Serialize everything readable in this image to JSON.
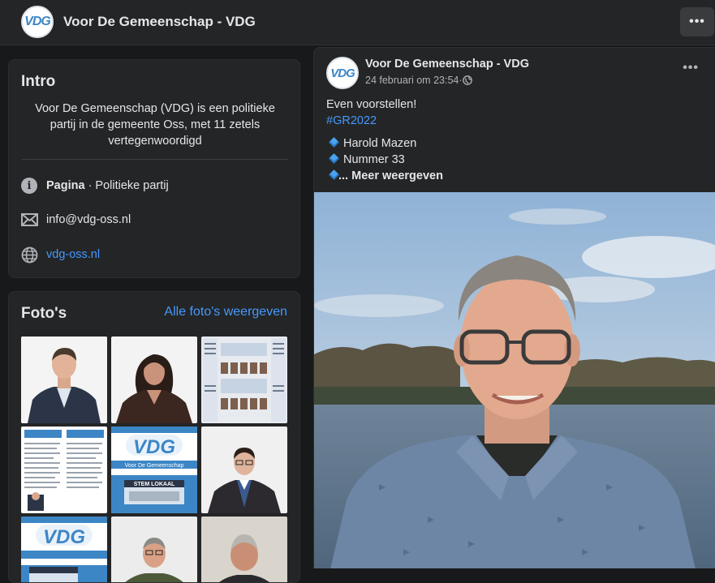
{
  "header": {
    "page_name": "Voor De Gemeenschap - VDG",
    "logo_text": "VDG",
    "more_label": "•••"
  },
  "intro": {
    "title": "Intro",
    "description": "Voor De Gemeenschap (VDG) is een politieke partij in de gemeente Oss, met 11 zetels vertegenwoordigd",
    "category_label": "Pagina",
    "category_value": " · Politieke partij",
    "email": "info@vdg-oss.nl",
    "website": "vdg-oss.nl"
  },
  "photos": {
    "title": "Foto's",
    "see_all": "Alle foto's weergeven",
    "items": [
      {
        "kind": "portrait",
        "bg": "#f2f2f2"
      },
      {
        "kind": "portrait",
        "bg": "#f2f2f2"
      },
      {
        "kind": "poster",
        "bg": "#e7eaef"
      },
      {
        "kind": "document",
        "bg": "#ffffff"
      },
      {
        "kind": "logo-banner",
        "bg": "#ffffff"
      },
      {
        "kind": "portrait",
        "bg": "#f0f0f0"
      },
      {
        "kind": "logo-banner",
        "bg": "#ffffff"
      },
      {
        "kind": "portrait",
        "bg": "#ececec"
      },
      {
        "kind": "portrait",
        "bg": "#d9d4cc"
      }
    ],
    "banner_caption": "Voor De Gemeenschap",
    "stem_text": "STEM LOKAAL"
  },
  "post": {
    "author": "Voor De Gemeenschap - VDG",
    "date": "24 februari om 23:54",
    "separator": " · ",
    "more_label": "•••",
    "intro_line": "Even voorstellen!",
    "hashtag": "#GR2022",
    "bullet_1": "Harold Mazen",
    "bullet_2": "Nummer 33",
    "see_more": "... Meer weergeven"
  },
  "colors": {
    "background": "#18191a",
    "card": "#242526",
    "link": "#4599ff",
    "brand_blue": "#3d86c6"
  }
}
